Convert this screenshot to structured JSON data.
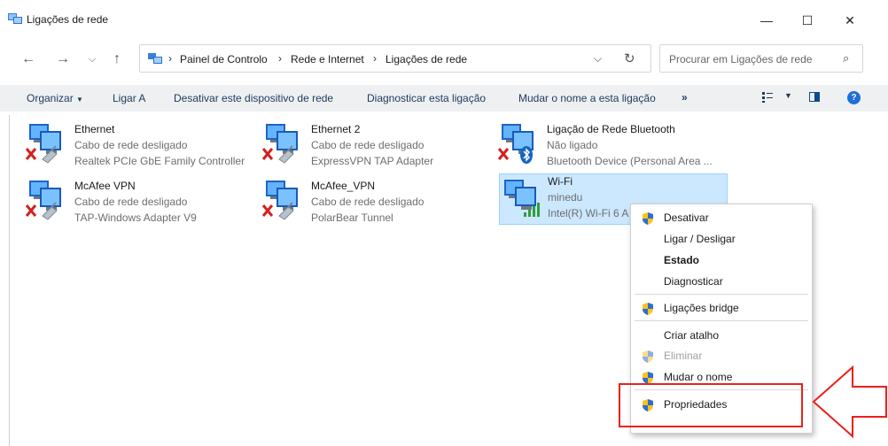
{
  "window": {
    "title": "Ligações de rede",
    "controls": [
      "minimize-icon",
      "maximize-icon",
      "close-icon"
    ]
  },
  "nav": {
    "breadcrumb": [
      "Painel de Controlo",
      "Rede e Internet",
      "Ligações de rede"
    ],
    "search_placeholder": "Procurar em Ligações de rede"
  },
  "commands": {
    "organize": "Organizar",
    "items": [
      "Ligar A",
      "Desativar este dispositivo de rede",
      "Diagnosticar esta ligação",
      "Mudar o nome a esta ligação"
    ],
    "more": "»"
  },
  "connections": [
    {
      "name": "Ethernet",
      "status": "Cabo de rede desligado",
      "device": "Realtek PCIe GbE Family Controller",
      "badge": "disconnected"
    },
    {
      "name": "Ethernet 2",
      "status": "Cabo de rede desligado",
      "device": "ExpressVPN TAP Adapter",
      "badge": "disconnected"
    },
    {
      "name": "Ligação de Rede Bluetooth",
      "status": "Não ligado",
      "device": "Bluetooth Device (Personal Area ...",
      "badge": "bluetooth"
    },
    {
      "name": "McAfee VPN",
      "status": "Cabo de rede desligado",
      "device": "TAP-Windows Adapter V9",
      "badge": "disconnected"
    },
    {
      "name": "McAfee_VPN",
      "status": "Cabo de rede desligado",
      "device": "PolarBear Tunnel",
      "badge": "disconnected"
    },
    {
      "name": "Wi-Fi",
      "status": "minedu",
      "device": "Intel(R) Wi-Fi 6 A",
      "badge": "signal",
      "selected": true
    }
  ],
  "context_menu": {
    "items": [
      {
        "label": "Desativar",
        "shield": true
      },
      {
        "label": "Ligar / Desligar",
        "shield": false
      },
      {
        "label": "Estado",
        "shield": false,
        "bold": true
      },
      {
        "label": "Diagnosticar",
        "shield": false
      },
      {
        "label": "Ligações bridge",
        "shield": true
      },
      {
        "label": "Criar atalho",
        "shield": false
      },
      {
        "label": "Eliminar",
        "shield": true,
        "disabled": true
      },
      {
        "label": "Mudar o nome",
        "shield": true
      },
      {
        "label": "Propriedades",
        "shield": true
      }
    ]
  },
  "colors": {
    "accent": "#1e6fd9",
    "selection": "#cce8ff",
    "annotation": "#e8211d",
    "command_bar": "#eef0f2"
  }
}
